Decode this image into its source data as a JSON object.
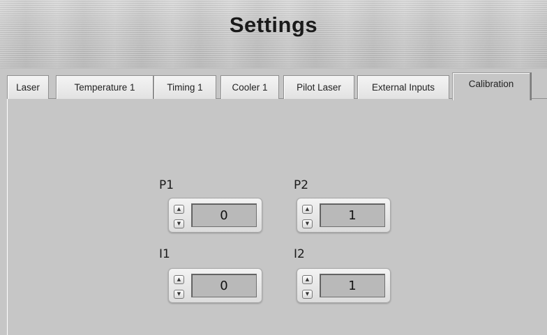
{
  "header": {
    "title": "Settings"
  },
  "tabs": [
    {
      "label": "Laser",
      "active": false
    },
    {
      "label": "Temperature 1",
      "active": false
    },
    {
      "label": "Timing 1",
      "active": false
    },
    {
      "label": "Cooler 1",
      "active": false
    },
    {
      "label": "Pilot Laser",
      "active": false
    },
    {
      "label": "External Inputs",
      "active": false
    },
    {
      "label": "Calibration",
      "active": true
    }
  ],
  "controls": {
    "p1": {
      "label": "P1",
      "value": "0"
    },
    "p2": {
      "label": "P2",
      "value": "1"
    },
    "i1": {
      "label": "I1",
      "value": "0"
    },
    "i2": {
      "label": "I2",
      "value": "1"
    }
  },
  "icons": {
    "increment": "triangle-up-icon",
    "decrement": "triangle-down-icon"
  }
}
